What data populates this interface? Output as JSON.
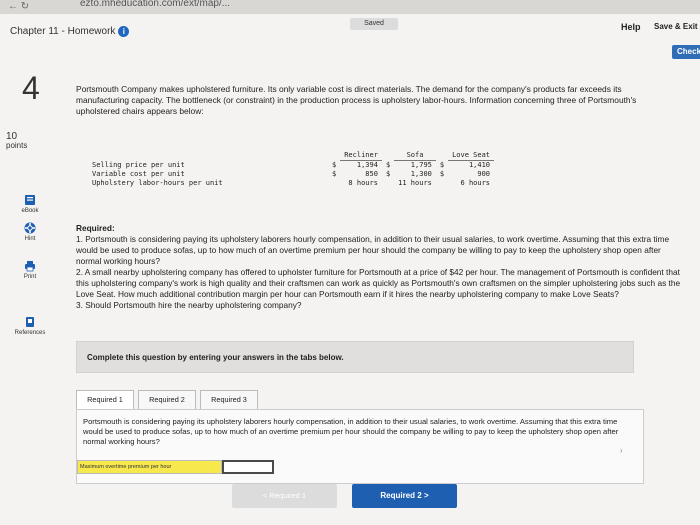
{
  "browser": {
    "url_fragment": "ezto.mheducation.com/ext/map/..."
  },
  "header": {
    "chapter_title": "Chapter 11 - Homework",
    "saved_label": "Saved",
    "help_label": "Help",
    "save_exit_label": "Save & Exit",
    "check_label": "Check"
  },
  "question": {
    "number": "4",
    "points_value": "10",
    "points_label": "points",
    "intro": "Portsmouth Company makes upholstered furniture. Its only variable cost is direct materials. The demand for the company's products far exceeds its manufacturing capacity. The bottleneck (or constraint) in the production process is upholstery labor-hours. Information concerning three of Portsmouth's upholstered chairs appears below:"
  },
  "sidebar_tools": [
    {
      "label": "eBook",
      "icon": "ebook-icon"
    },
    {
      "label": "Hint",
      "icon": "hint-icon"
    },
    {
      "label": "Print",
      "icon": "print-icon"
    },
    {
      "label": "References",
      "icon": "references-icon"
    }
  ],
  "product_table": {
    "headers": [
      "Recliner",
      "Sofa",
      "Love Seat"
    ],
    "rows": [
      {
        "label": "Selling price per unit",
        "cur1": "$",
        "v1": "1,394",
        "cur2": "$",
        "v2": "1,795",
        "cur3": "$",
        "v3": "1,410"
      },
      {
        "label": "Variable cost per unit",
        "cur1": "$",
        "v1": "850",
        "cur2": "$",
        "v2": "1,300",
        "cur3": "$",
        "v3": "900"
      },
      {
        "label": "Upholstery labor-hours per unit",
        "cur1": "",
        "v1": "8 hours",
        "cur2": "",
        "v2": "11 hours",
        "cur3": "",
        "v3": "6 hours"
      }
    ]
  },
  "required": {
    "heading": "Required:",
    "items": [
      "1. Portsmouth is considering paying its upholstery laborers hourly compensation, in addition to their usual salaries, to work overtime. Assuming that this extra time would be used to produce sofas, up to how much of an overtime premium per hour should the company be willing to pay to keep the upholstery shop open after normal working hours?",
      "2. A small nearby upholstering company has offered to upholster furniture for Portsmouth at a price of $42 per hour. The management of Portsmouth is confident that this upholstering company's work is high quality and their craftsmen can work as quickly as Portsmouth's own craftsmen on the simpler upholstering jobs such as the Love Seat. How much additional contribution margin per hour can Portsmouth earn if it hires the nearby upholstering company to make Love Seats?",
      "3. Should Portsmouth hire the nearby upholstering company?"
    ]
  },
  "instructions": "Complete this question by entering your answers in the tabs below.",
  "tabs": [
    "Required 1",
    "Required 2",
    "Required 3"
  ],
  "panel": {
    "text": "Portsmouth is considering paying its upholstery laborers hourly compensation, in addition to their usual salaries, to work overtime. Assuming that this extra time would be used to produce sofas, up to how much of an overtime premium per hour should the company be willing to pay to keep the upholstery shop open after normal working hours?",
    "answer_label": "Maximum overtime premium per hour",
    "answer_value": ""
  },
  "navigation": {
    "prev_label": "< Required 1",
    "next_label": "Required 2 >"
  }
}
